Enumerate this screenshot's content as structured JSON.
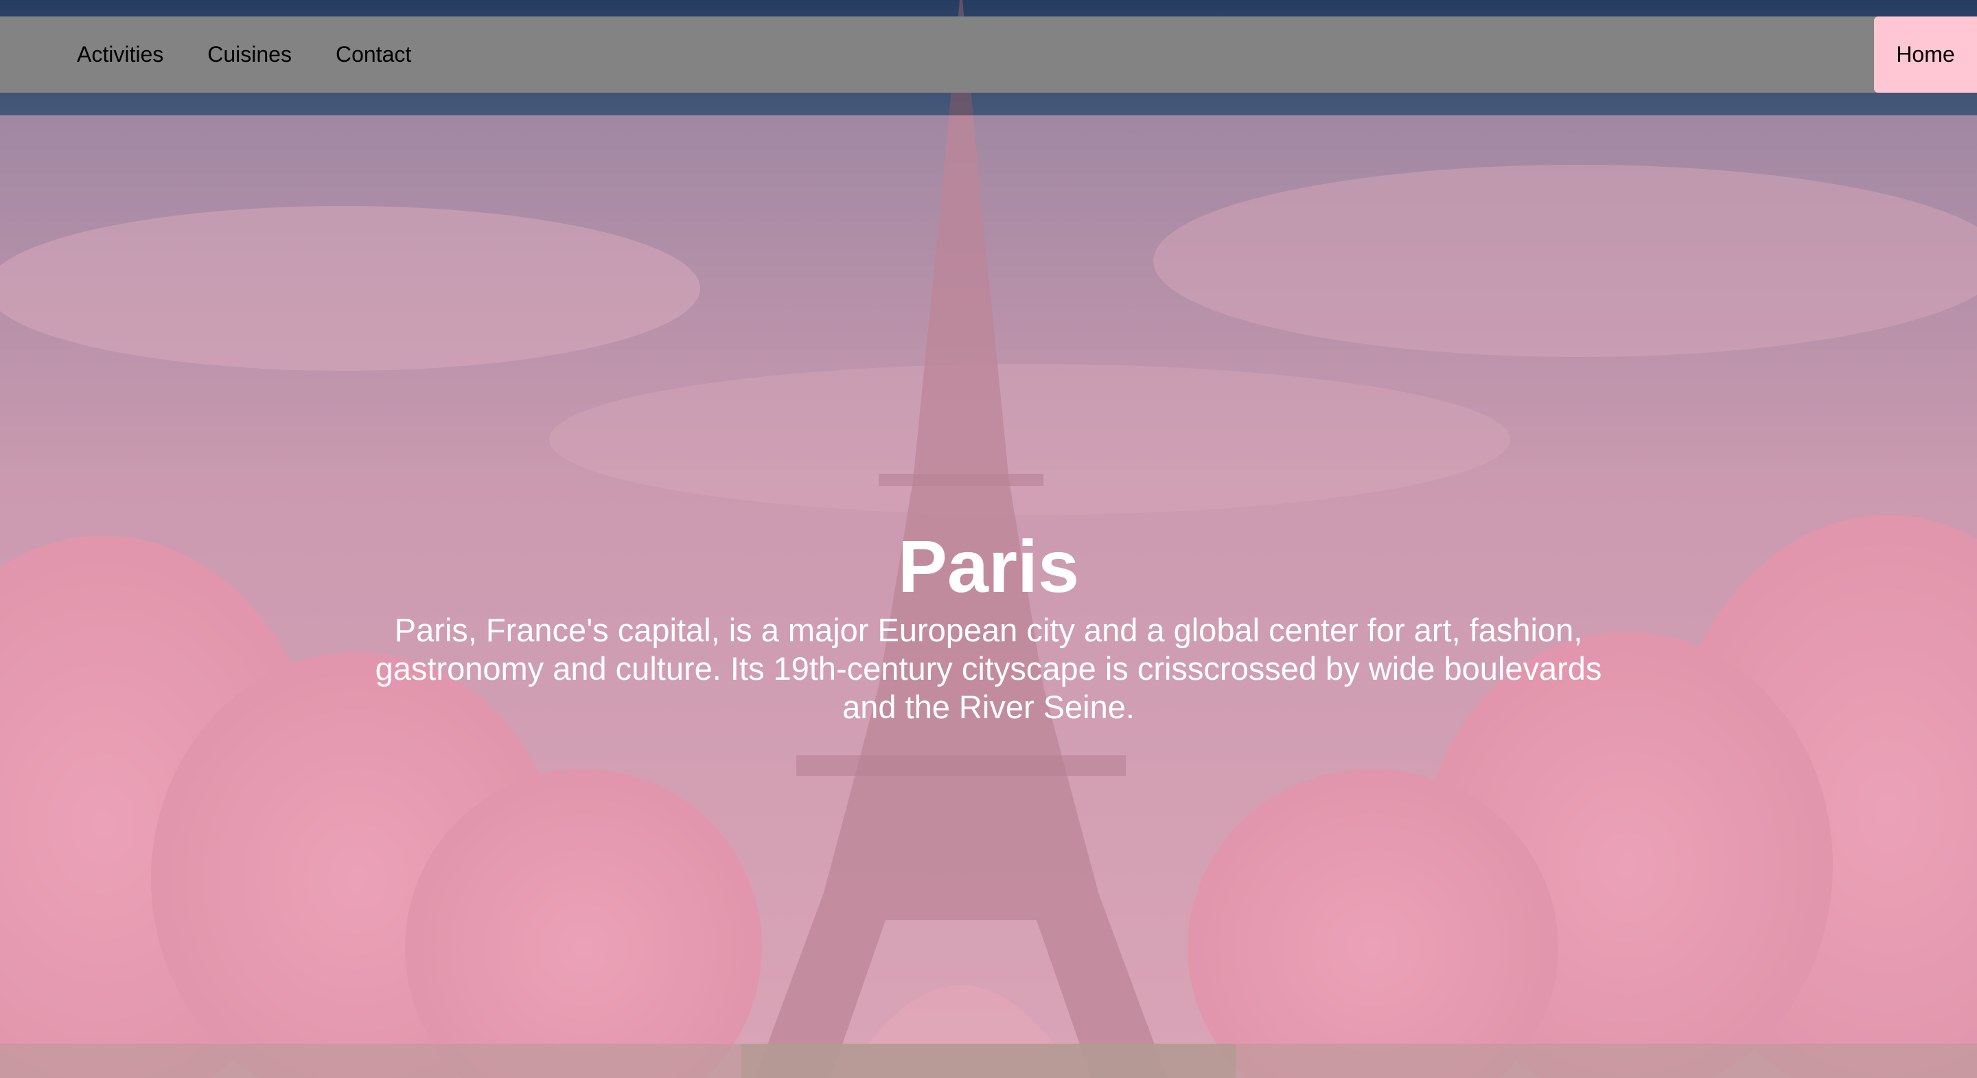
{
  "nav": {
    "links": [
      "Activities",
      "Cuisines",
      "Contact"
    ],
    "home_label": "Home"
  },
  "hero": {
    "title": "Paris",
    "description": "Paris, France's capital, is a major European city and a global center for art, fashion, gastronomy and culture. Its 19th-century cityscape is crisscrossed by wide boulevards and the River Seine."
  },
  "colors": {
    "navbar": "#838383",
    "home_button": "#ffc6d4",
    "overlay": "#e8a8ba",
    "hero_text": "#ffffff"
  },
  "background_image": "eiffel-tower-with-pink-blossom-trees"
}
